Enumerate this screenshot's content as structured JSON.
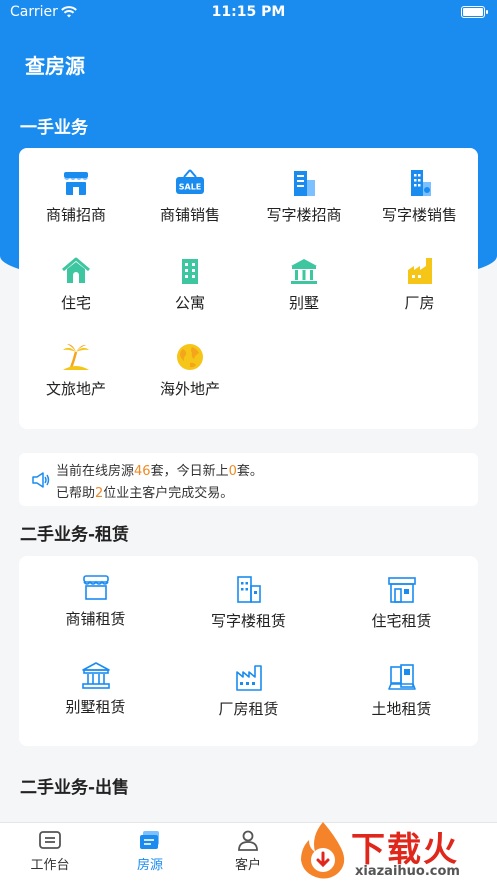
{
  "status_bar": {
    "carrier": "Carrier",
    "time": "11:15 PM"
  },
  "header": {
    "title": "查房源"
  },
  "first_hand": {
    "title": "一手业务",
    "items": [
      {
        "label": "商铺招商",
        "icon": "shop-icon"
      },
      {
        "label": "商铺销售",
        "icon": "sale-sign-icon"
      },
      {
        "label": "写字楼招商",
        "icon": "office-building-icon"
      },
      {
        "label": "写字楼销售",
        "icon": "office-sale-icon"
      },
      {
        "label": "住宅",
        "icon": "house-icon"
      },
      {
        "label": "公寓",
        "icon": "apartment-icon"
      },
      {
        "label": "别墅",
        "icon": "villa-icon"
      },
      {
        "label": "厂房",
        "icon": "factory-icon"
      },
      {
        "label": "文旅地产",
        "icon": "palm-island-icon"
      },
      {
        "label": "海外地产",
        "icon": "globe-icon"
      }
    ]
  },
  "notice": {
    "line1_prefix": "当前在线房源",
    "online_count": "46",
    "line1_mid": "套，今日新上",
    "new_today": "0",
    "line1_suffix": "套。",
    "line2_prefix": "已帮助",
    "helped_count": "2",
    "line2_suffix": "位业主客户完成交易。"
  },
  "second_hand_rent": {
    "title": "二手业务-租赁",
    "items": [
      {
        "label": "商铺租赁",
        "icon": "shop-outline-icon"
      },
      {
        "label": "写字楼租赁",
        "icon": "office-outline-icon"
      },
      {
        "label": "住宅租赁",
        "icon": "house-outline-icon"
      },
      {
        "label": "别墅租赁",
        "icon": "villa-outline-icon"
      },
      {
        "label": "厂房租赁",
        "icon": "factory-outline-icon"
      },
      {
        "label": "土地租赁",
        "icon": "land-outline-icon"
      }
    ]
  },
  "second_hand_sale": {
    "title": "二手业务-出售"
  },
  "tabbar": {
    "tabs": [
      {
        "label": "工作台",
        "icon": "workbench-icon",
        "active": false
      },
      {
        "label": "房源",
        "icon": "listing-icon",
        "active": true
      },
      {
        "label": "客户",
        "icon": "client-icon",
        "active": false
      }
    ]
  },
  "watermark": {
    "main": "下载火",
    "sub": "xiazaihuo.com"
  },
  "colors": {
    "primary": "#1a8cf0",
    "highlight": "#f08a24",
    "yellow": "#f5c518",
    "green": "#3ec6a0"
  }
}
